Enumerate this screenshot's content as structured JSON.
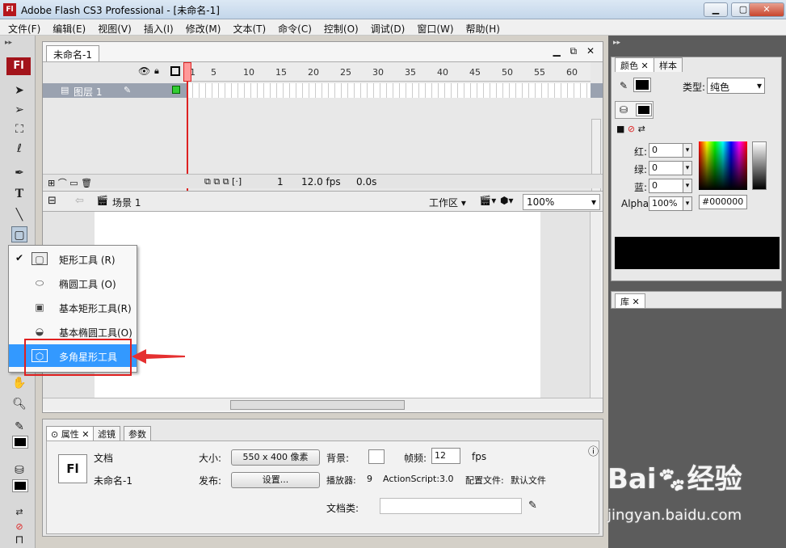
{
  "window": {
    "title": "Adobe Flash CS3 Professional - [未命名-1]",
    "app_logo": "Fl",
    "min": "▁",
    "max": "▢",
    "close": "✕"
  },
  "menu": [
    "文件(F)",
    "编辑(E)",
    "视图(V)",
    "插入(I)",
    "修改(M)",
    "文本(T)",
    "命令(C)",
    "控制(O)",
    "调试(D)",
    "窗口(W)",
    "帮助(H)"
  ],
  "toolbox": {
    "logo": "Fl"
  },
  "document": {
    "tab": "未命名-1",
    "timeline": {
      "frame_numbers": [
        "1",
        "5",
        "10",
        "15",
        "20",
        "25",
        "30",
        "35",
        "40",
        "45",
        "50",
        "55",
        "60"
      ],
      "layer_name": "图层 1",
      "current_frame": "1",
      "fps": "12.0 fps",
      "time": "0.0s"
    },
    "scene": "场景 1",
    "workspace_label": "工作区",
    "zoom": "100%"
  },
  "shape_menu": {
    "items": [
      {
        "label": "矩形工具 (R)",
        "checked": true
      },
      {
        "label": "椭圆工具 (O)",
        "checked": false
      },
      {
        "label": "基本矩形工具(R)",
        "checked": false
      },
      {
        "label": "基本椭圆工具(O)",
        "checked": false
      },
      {
        "label": "多角星形工具",
        "checked": false,
        "selected": true
      }
    ],
    "check_mark": "✔"
  },
  "color_panel": {
    "tabs": [
      "颜色",
      "样本"
    ],
    "type_label": "类型:",
    "type_value": "纯色",
    "red_label": "红:",
    "red": "0",
    "green_label": "绿:",
    "green": "0",
    "blue_label": "蓝:",
    "blue": "0",
    "alpha_label": "Alpha:",
    "alpha": "100%",
    "hex": "#000000",
    "fill_color": "#000000"
  },
  "library_panel": {
    "tab": "库"
  },
  "properties": {
    "tabs": [
      "属性",
      "滤镜",
      "参数"
    ],
    "doc_type": "文档",
    "doc_name": "未命名-1",
    "doc_icon": "Fl",
    "size_label": "大小:",
    "size_value": "550 x 400 像素",
    "publish_label": "发布:",
    "settings_btn": "设置...",
    "bg_label": "背景:",
    "fps_label": "帧频:",
    "fps_value": "12",
    "fps_unit": "fps",
    "player_label": "播放器:",
    "player_value": "9",
    "as_label": "ActionScript:",
    "as_value": "3.0",
    "profile_label": "配置文件:",
    "profile_value": "默认文件",
    "docclass_label": "文档类:"
  },
  "watermark": {
    "text1": "Bai",
    "text2": "经验",
    "url": "jingyan.baidu.com"
  }
}
